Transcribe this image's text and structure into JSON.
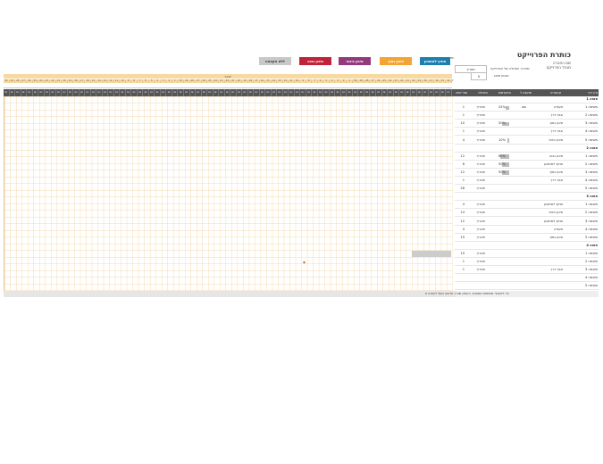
{
  "header": {
    "title": "כותרת הפרוייקט",
    "company": "שם החברה",
    "manager": "מנהל הפרוייקט",
    "start_label": "תאריך התחלה של הפרוייקט:",
    "start_value": "תאריך",
    "week_label": "שבוע מוצג:",
    "week_value": "0",
    "legend_label": "מקרא:"
  },
  "legend": [
    {
      "label": "מחוץ למתוכנן",
      "color": "#1d7fae"
    },
    {
      "label": "סיכון נמוך",
      "color": "#f2a533"
    },
    {
      "label": "סיכון בינוני",
      "color": "#933a7d"
    },
    {
      "label": "סיכון גבוה",
      "color": "#c0223a"
    },
    {
      "label": "ללא הקצאה",
      "color": "#c8c8c8"
    }
  ],
  "timeline": {
    "month": "ינואר",
    "week": "שבוע"
  },
  "columns": {
    "milestone": "ציון דרך",
    "category": "קטגוריה",
    "assigned": "מוקצה ל",
    "progress": "התקדמות",
    "start": "התחלה",
    "days": "מס' ימים"
  },
  "rows": [
    {
      "type": "phase",
      "label": "פאזה 1"
    },
    {
      "type": "task",
      "label": "משימה 1",
      "category": "מעודה",
      "assigned": "שם",
      "progress": "25%",
      "pct": 25,
      "start": "תאריך",
      "days": "1"
    },
    {
      "type": "task",
      "label": "משימה 2",
      "category": "אבני דרך",
      "assigned": "",
      "progress": "",
      "pct": 0,
      "start": "תאריך",
      "days": "1"
    },
    {
      "type": "task",
      "label": "משימה 3",
      "category": "סיכון נמוך",
      "assigned": "",
      "progress": "50%",
      "pct": 50,
      "start": "תאריך",
      "days": "10"
    },
    {
      "type": "task",
      "label": "משימה 4",
      "category": "אבני דרך",
      "assigned": "",
      "progress": "",
      "pct": 0,
      "start": "תאריך",
      "days": "1"
    },
    {
      "type": "task",
      "label": "משימה 5",
      "category": "סיכון בינוני",
      "assigned": "",
      "progress": "10%",
      "pct": 10,
      "start": "תאריך",
      "days": "4"
    },
    {
      "type": "phase",
      "label": "פאזה 2"
    },
    {
      "type": "task",
      "label": "משימה 1",
      "category": "סיכון גבוה",
      "assigned": "",
      "progress": "60%",
      "pct": 60,
      "start": "תאריך",
      "days": "12"
    },
    {
      "type": "task",
      "label": "משימה 2",
      "category": "מחוץ למתוכנן",
      "assigned": "",
      "progress": "50%",
      "pct": 50,
      "start": "תאריך",
      "days": "8"
    },
    {
      "type": "task",
      "label": "משימה 3",
      "category": "סיכון נמוך",
      "assigned": "",
      "progress": "50%",
      "pct": 50,
      "start": "תאריך",
      "days": "12"
    },
    {
      "type": "task",
      "label": "משימה 4",
      "category": "אבני דרך",
      "assigned": "",
      "progress": "",
      "pct": 0,
      "start": "תאריך",
      "days": "1"
    },
    {
      "type": "task",
      "label": "משימה 5",
      "category": "",
      "assigned": "",
      "progress": "",
      "pct": 0,
      "start": "תאריך",
      "days": "28"
    },
    {
      "type": "phase",
      "label": "פאזה 3"
    },
    {
      "type": "task",
      "label": "משימה 1",
      "category": "מחוץ למתוכנן",
      "assigned": "",
      "progress": "",
      "pct": 0,
      "start": "תאריך",
      "days": "4"
    },
    {
      "type": "task",
      "label": "משימה 2",
      "category": "סיכון בינוני",
      "assigned": "",
      "progress": "",
      "pct": 0,
      "start": "תאריך",
      "days": "14"
    },
    {
      "type": "task",
      "label": "משימה 3",
      "category": "מחוץ למתוכנן",
      "assigned": "",
      "progress": "",
      "pct": 0,
      "start": "תאריך",
      "days": "12"
    },
    {
      "type": "task",
      "label": "משימה 4",
      "category": "מעודה",
      "assigned": "",
      "progress": "",
      "pct": 0,
      "start": "תאריך",
      "days": "4"
    },
    {
      "type": "task",
      "label": "משימה 5",
      "category": "סיכון נמוך",
      "assigned": "",
      "progress": "",
      "pct": 0,
      "start": "תאריך",
      "days": "19"
    },
    {
      "type": "phase",
      "label": "פאזה 4"
    },
    {
      "type": "task",
      "label": "משימה 1",
      "category": "",
      "assigned": "",
      "progress": "",
      "pct": 0,
      "start": "תאריך",
      "days": "19"
    },
    {
      "type": "task",
      "label": "משימה 2",
      "category": "",
      "assigned": "",
      "progress": "",
      "pct": 0,
      "start": "תאריך",
      "days": "1"
    },
    {
      "type": "task",
      "label": "משימה 3",
      "category": "אבני דרך",
      "assigned": "",
      "progress": "",
      "pct": 0,
      "start": "תאריך",
      "days": "1"
    },
    {
      "type": "task",
      "label": "משימה 4",
      "category": "",
      "assigned": "",
      "progress": "",
      "pct": 0,
      "start": "",
      "days": ""
    },
    {
      "type": "task",
      "label": "משימה 5",
      "category": "",
      "assigned": "",
      "progress": "",
      "pct": 0,
      "start": "",
      "days": ""
    }
  ],
  "footer": "כדי להוסיף משימות נוספות, העתק שורה חדשה מעל לשורה זו",
  "colors": {
    "header": "#555555",
    "grid": "#f3d9b0",
    "timeline": "#f8d9a0"
  }
}
